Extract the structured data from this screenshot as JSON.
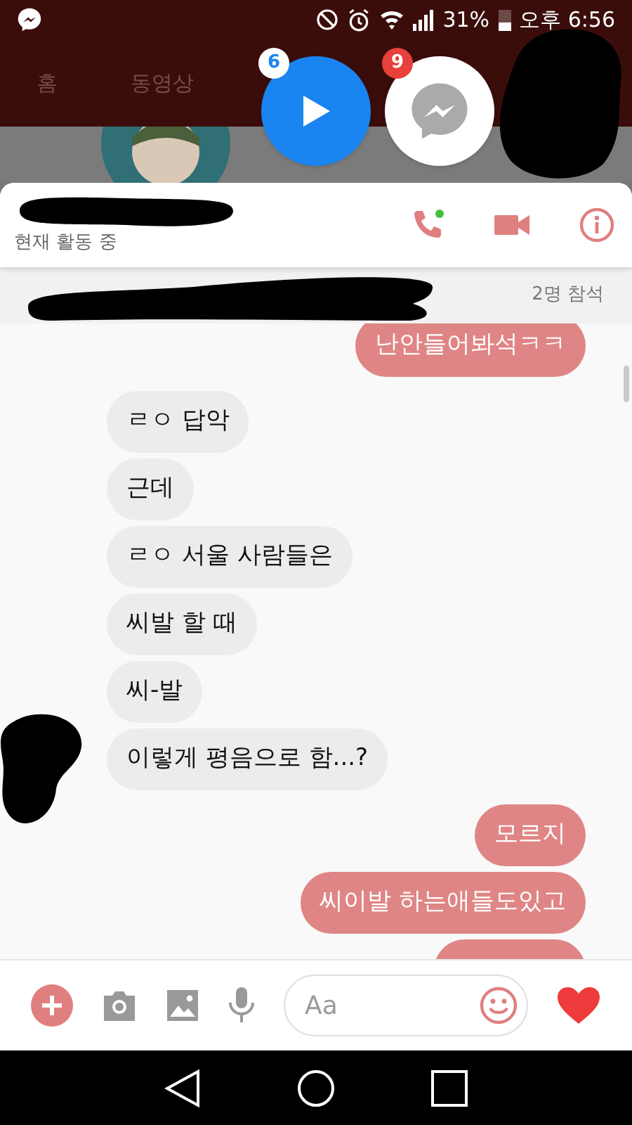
{
  "status_bar": {
    "battery": "31%",
    "time": "오후 6:56"
  },
  "background_app": {
    "tabs": [
      {
        "label": "홈"
      },
      {
        "label": "동영상"
      }
    ]
  },
  "chat_heads": [
    {
      "kind": "video",
      "badge": "6"
    },
    {
      "kind": "messenger",
      "badge": "9"
    }
  ],
  "chat": {
    "status": "현재 활동 중",
    "participants": "2명 참석",
    "messages": [
      {
        "kind": "text",
        "sent": true,
        "text": "난안들어봐석ㅋㅋ"
      },
      {
        "kind": "text",
        "sent": false,
        "text": "ㄹㅇ 답악"
      },
      {
        "kind": "text",
        "sent": false,
        "text": "근데"
      },
      {
        "kind": "text",
        "sent": false,
        "text": "ㄹㅇ 서울 사람들은"
      },
      {
        "kind": "text",
        "sent": false,
        "text": "씨발 할 때"
      },
      {
        "kind": "text",
        "sent": false,
        "text": "씨-발"
      },
      {
        "kind": "text",
        "sent": false,
        "text": "이렇게 평음으로 함...?"
      },
      {
        "kind": "text",
        "sent": true,
        "text": "모르지"
      },
      {
        "kind": "text",
        "sent": true,
        "text": "씨이발 하는애들도있고"
      },
      {
        "kind": "partial",
        "sent": true
      }
    ]
  },
  "composer": {
    "placeholder": "Aa"
  }
}
